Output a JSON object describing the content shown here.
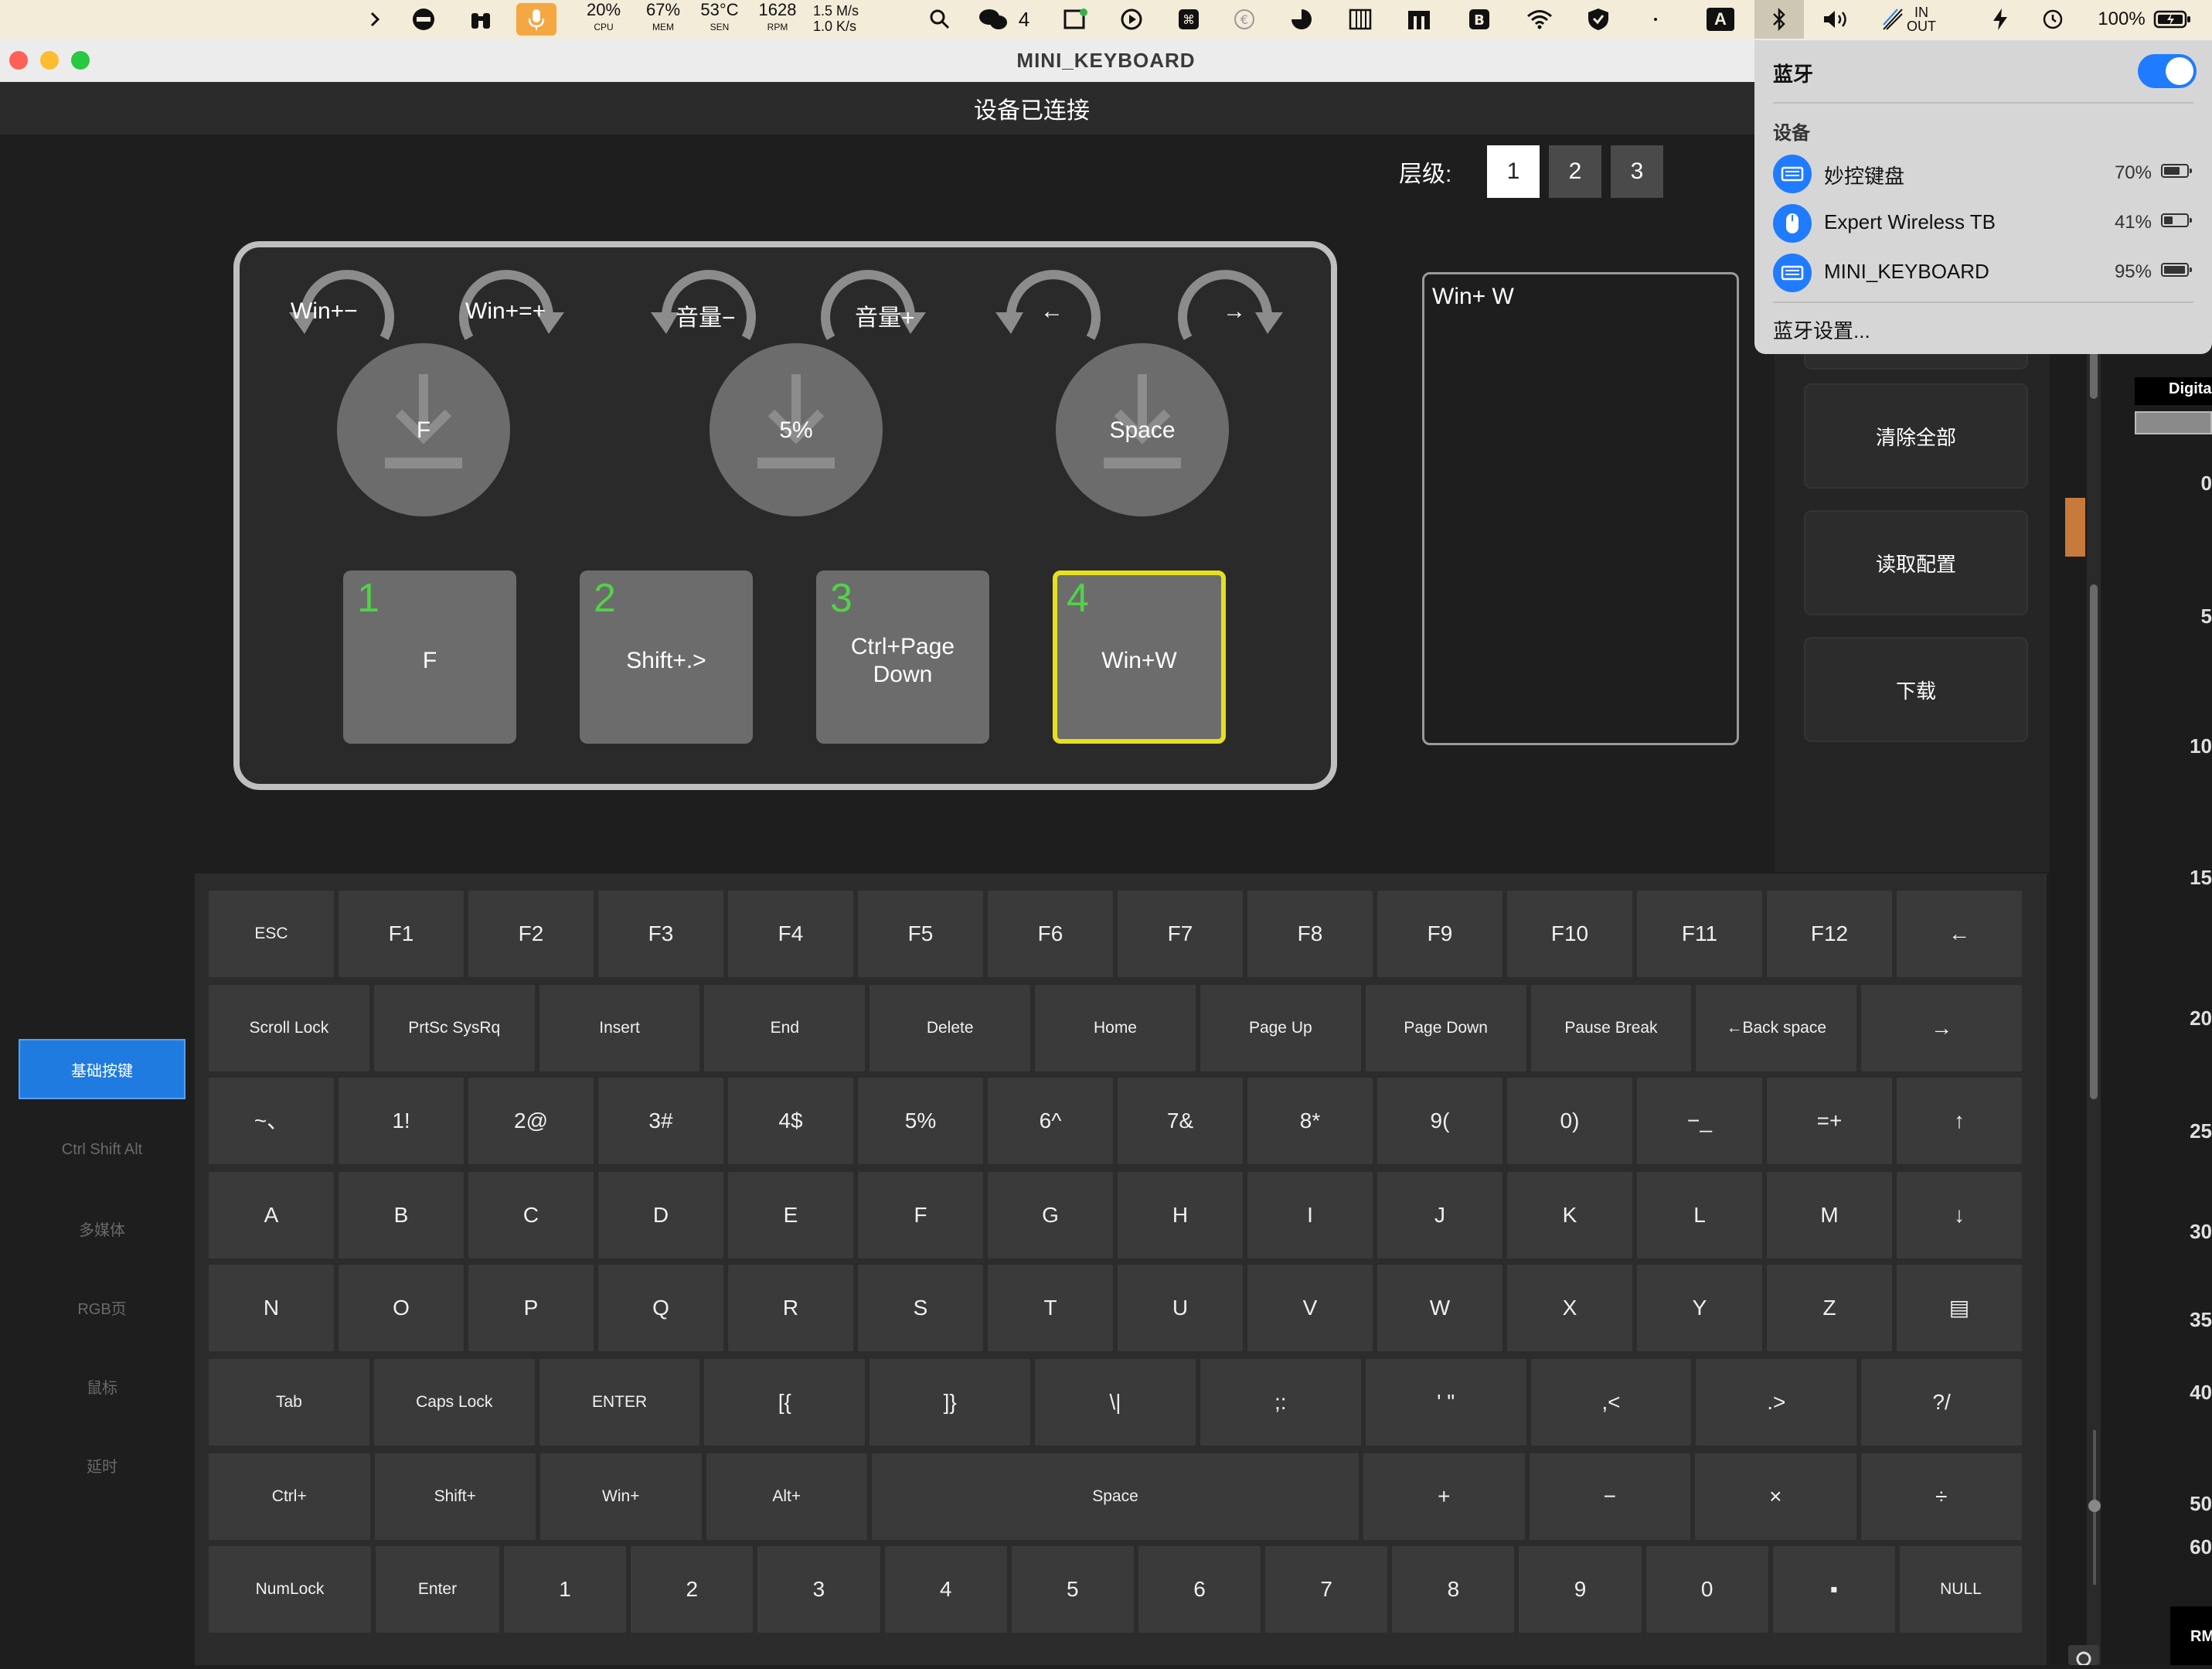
{
  "menubar": {
    "cpu": {
      "value": "20%",
      "label": "CPU"
    },
    "mem": {
      "value": "67%",
      "label": "MEM"
    },
    "sen": {
      "value": "53°C",
      "label": "SEN"
    },
    "rpm": {
      "value": "1628",
      "label": "RPM"
    },
    "net_up": "1.5 M/s",
    "net_down": "1.0 K/s",
    "wechat_count": "4",
    "input_letter": "A",
    "in_label": "IN",
    "out_label": "OUT",
    "battery": "100%"
  },
  "window": {
    "title": "MINI_KEYBOARD"
  },
  "header": {
    "status": "设备已连接"
  },
  "layers": {
    "label": "层级:",
    "items": [
      "1",
      "2",
      "3"
    ],
    "selected": "1"
  },
  "encoders": [
    {
      "left_label": "Win+−",
      "right_label": "Win+=+",
      "press": "F"
    },
    {
      "left_label": "音量−",
      "right_label": "音量+",
      "press": "5%"
    },
    {
      "left_label": "←",
      "right_label": "→",
      "press": "Space"
    }
  ],
  "pads": [
    {
      "num": "1",
      "label": "F"
    },
    {
      "num": "2",
      "label": "Shift+.>"
    },
    {
      "num": "3",
      "label": "Ctrl+Page Down"
    },
    {
      "num": "4",
      "label": "Win+W"
    }
  ],
  "preview": {
    "text": "Win+ W"
  },
  "actions": {
    "clear": "清除全部",
    "read": "读取配置",
    "download": "下载"
  },
  "tabs": [
    "基础按键",
    "Ctrl Shift Alt",
    "多媒体",
    "RGB页",
    "鼠标",
    "延时"
  ],
  "tabs_selected": "基础按键",
  "keyboard": {
    "rows": [
      [
        "ESC",
        "F1",
        "F2",
        "F3",
        "F4",
        "F5",
        "F6",
        "F7",
        "F8",
        "F9",
        "F10",
        "F11",
        "F12",
        "←"
      ],
      [
        "Scroll Lock",
        "PrtSc SysRq",
        "Insert",
        "End",
        "Delete",
        "Home",
        "Page Up",
        "Page Down",
        "Pause Break",
        "←Back space",
        "→"
      ],
      [
        "~、",
        "1!",
        "2@",
        "3#",
        "4$",
        "5%",
        "6^",
        "7&",
        "8*",
        "9(",
        "0)",
        "−_",
        "=+",
        "↑"
      ],
      [
        "A",
        "B",
        "C",
        "D",
        "E",
        "F",
        "G",
        "H",
        "I",
        "J",
        "K",
        "L",
        "M",
        "↓"
      ],
      [
        "N",
        "O",
        "P",
        "Q",
        "R",
        "S",
        "T",
        "U",
        "V",
        "W",
        "X",
        "Y",
        "Z",
        "▤"
      ],
      [
        "Tab",
        "Caps Lock",
        "ENTER",
        "[{",
        "]}",
        "\\|",
        ";:",
        "' \"",
        ",<",
        ".>",
        "?/"
      ],
      [
        "Ctrl+",
        "Shift+",
        "Win+",
        "Alt+",
        "Space",
        "+",
        "−",
        "×",
        "÷"
      ],
      [
        "NumLock",
        "Enter",
        "1",
        "2",
        "3",
        "4",
        "5",
        "6",
        "7",
        "8",
        "9",
        "0",
        "▪",
        "NULL"
      ]
    ]
  },
  "bluetooth": {
    "title": "蓝牙",
    "section": "设备",
    "devices": [
      {
        "name": "妙控键盘",
        "battery": "70%",
        "level": 0.7
      },
      {
        "name": "Expert Wireless TB",
        "battery": "41%",
        "level": 0.41
      },
      {
        "name": "MINI_KEYBOARD",
        "battery": "95%",
        "level": 0.95
      }
    ],
    "settings": "蓝牙设置..."
  },
  "right_edge": {
    "digita": "Digita",
    "ruler": [
      "0",
      "5",
      "10",
      "15",
      "20",
      "25",
      "30",
      "35",
      "40",
      "50",
      "60"
    ],
    "rm": "RM"
  },
  "colors": {
    "accent": "#1f7bff",
    "pad_number": "#52d24a",
    "pad_selected_border": "#e6e020",
    "tab_selected": "#1f7bdf"
  }
}
